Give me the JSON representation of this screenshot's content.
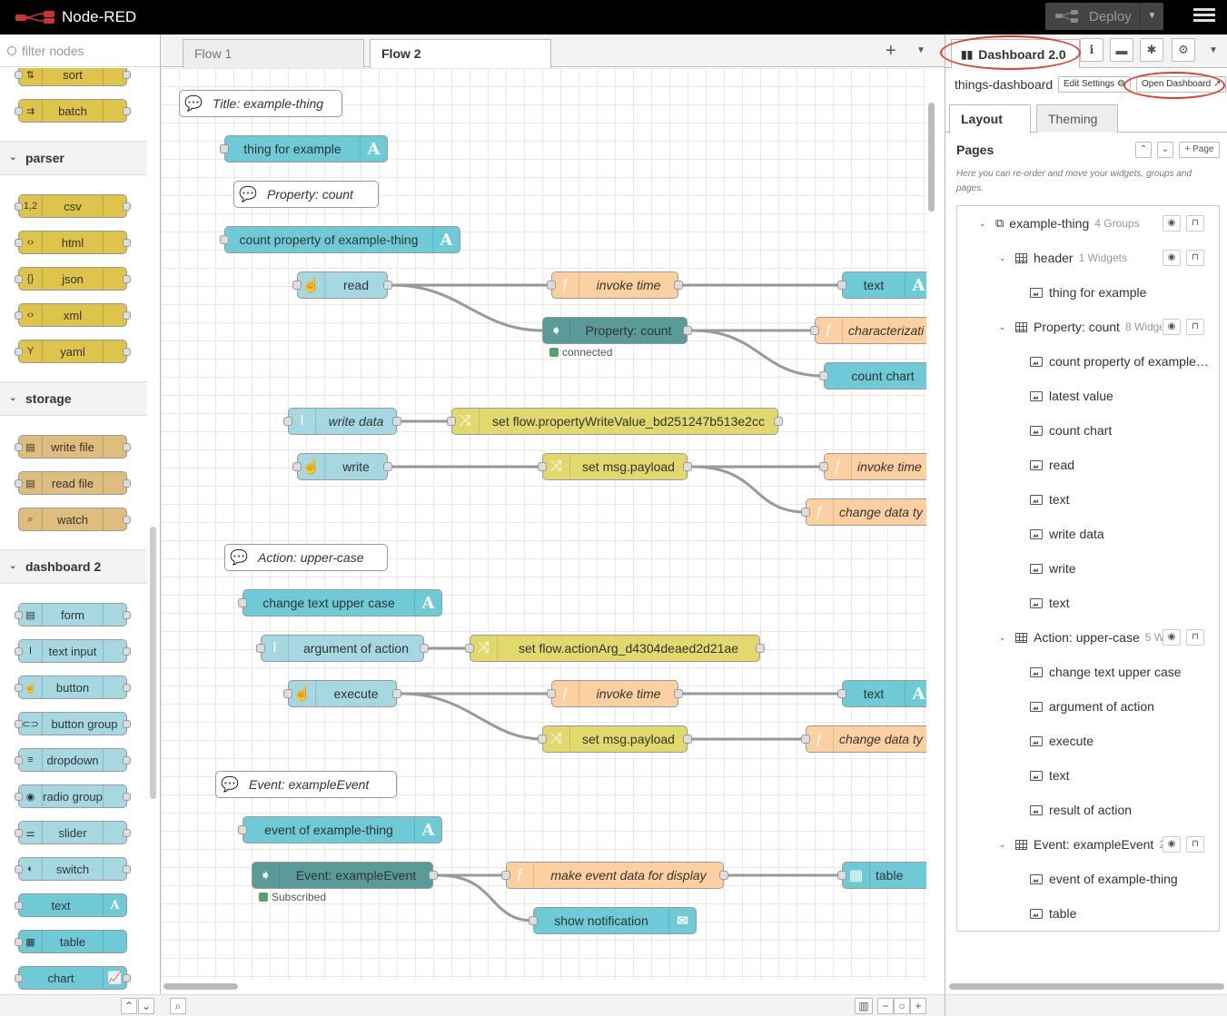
{
  "app": {
    "title": "Node-RED",
    "deploy_label": "Deploy"
  },
  "palette": {
    "filter_placeholder": "filter nodes",
    "categories": [
      {
        "name": "parser"
      },
      {
        "name": "storage"
      },
      {
        "name": "dashboard 2"
      }
    ],
    "nodes": {
      "sort": "sort",
      "batch": "batch",
      "csv": "csv",
      "html": "html",
      "json": "json",
      "xml": "xml",
      "yaml": "yaml",
      "write_file": "write file",
      "read_file": "read file",
      "watch": "watch",
      "form": "form",
      "text_input": "text input",
      "button": "button",
      "button_group": "button group",
      "dropdown": "dropdown",
      "radio_group": "radio group",
      "slider": "slider",
      "switch": "switch",
      "text": "text",
      "table": "table",
      "chart": "chart"
    }
  },
  "workspace": {
    "tabs": [
      {
        "label": "Flow 1"
      },
      {
        "label": "Flow 2"
      }
    ],
    "nodes": {
      "c1": "Title: example-thing",
      "n_thing": "thing for example",
      "c2": "Property: count",
      "n_count_prop": "count property of example-thing",
      "n_read": "read",
      "n_invoke1": "invoke time",
      "n_text1": "text",
      "n_mqtt1": "Property: count",
      "n_mqtt1_status": "connected",
      "n_character": "characterizati",
      "n_count_chart": "count chart",
      "n_write_data": "write data",
      "n_set_flow1": "set flow.propertyWriteValue_bd251247b513e2cc",
      "n_write": "write",
      "n_set_payload1": "set msg.payload",
      "n_invoke2": "invoke time",
      "n_change1": "change data ty",
      "c3": "Action: upper-case",
      "n_change_text": "change text upper case",
      "n_arg": "argument of action",
      "n_set_flow2": "set flow.actionArg_d4304deaed2d21ae",
      "n_execute": "execute",
      "n_invoke3": "invoke time",
      "n_text2": "text",
      "n_set_payload2": "set msg.payload",
      "n_change2": "change data ty",
      "c4": "Event: exampleEvent",
      "n_event": "event of example-thing",
      "n_mqtt2": "Event: exampleEvent",
      "n_mqtt2_status": "Subscribed",
      "n_make_event": "make event data for display",
      "n_table": "table",
      "n_notify": "show notification"
    }
  },
  "sidebar": {
    "tab_label": "Dashboard 2.0",
    "dashboard_name": "things-dashboard",
    "edit_settings": "Edit Settings",
    "open_dashboard": "Open Dashboard",
    "layout_tab": "Layout",
    "theming_tab": "Theming",
    "pages_heading": "Pages",
    "add_page": "Page",
    "help_text": "Here you can re-order and move your widgets, groups and pages.",
    "tree": {
      "page": {
        "label": "example-thing",
        "meta": "4 Groups"
      },
      "groups": [
        {
          "label": "header",
          "meta": "1 Widgets",
          "widgets": [
            "thing for example"
          ]
        },
        {
          "label": "Property: count",
          "meta": "8 Widge",
          "widgets": [
            "count property of example…",
            "latest value",
            "count chart",
            "read",
            "text",
            "write data",
            "write",
            "text"
          ]
        },
        {
          "label": "Action: upper-case",
          "meta": "5 W",
          "widgets": [
            "change text upper case",
            "argument of action",
            "execute",
            "text",
            "result of action"
          ]
        },
        {
          "label": "Event: exampleEvent",
          "meta": "2",
          "widgets": [
            "event of example-thing",
            "table"
          ]
        }
      ]
    }
  },
  "colors": {
    "annotation": "#e0402e",
    "dashboard_node": "#6ecad6",
    "function_node": "#fdd0a2",
    "change_node": "#e2d96e"
  }
}
